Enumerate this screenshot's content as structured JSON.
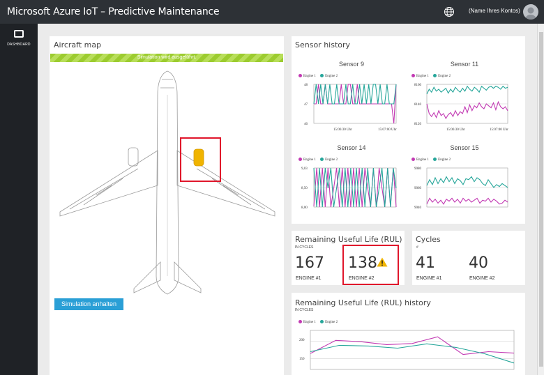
{
  "app": {
    "title": "Microsoft Azure IoT – Predictive Maintenance",
    "account": "(Name Ihres Kontos)"
  },
  "sidebar": {
    "items": [
      {
        "label": "DASHBOARD",
        "icon": "dashboard-icon"
      }
    ]
  },
  "aircraft_map": {
    "title": "Aircraft map",
    "banner": "Simulation wird ausgeführt.",
    "stop_button": "Simulation anhalten"
  },
  "sensor_history": {
    "title": "Sensor history",
    "legend": [
      "Engine 1",
      "Engine 2"
    ],
    "colors": {
      "engine1": "#c239b3",
      "engine2": "#26a69a"
    },
    "charts": [
      {
        "title": "Sensor 9",
        "yticks": [
          "48",
          "47",
          "46"
        ],
        "xticks": [
          "15:06:30 Uhr",
          "15:07:00 Uhr"
        ]
      },
      {
        "title": "Sensor 11",
        "yticks": [
          "8160",
          "8140",
          "8120"
        ],
        "xticks": [
          "15:06:30 Uhr",
          "15:07:00 Uhr"
        ]
      },
      {
        "title": "Sensor 14",
        "yticks": [
          "9,03",
          "8,50",
          "8,00"
        ],
        "xticks": [
          "15:06:30 Uhr",
          "15:07:00 Uhr"
        ]
      },
      {
        "title": "Sensor 15",
        "yticks": [
          "9080",
          "9060",
          "9040"
        ],
        "xticks": [
          "15:06:30 Uhr",
          "15:07:00 Uhr"
        ]
      }
    ]
  },
  "rul": {
    "title": "Remaining Useful Life (RUL)",
    "subtitle": "IN CYCLES",
    "engine1": {
      "value": "167",
      "label": "ENGINE #1"
    },
    "engine2": {
      "value": "138",
      "label": "ENGINE #2",
      "warning": true
    }
  },
  "cycles": {
    "title": "Cycles",
    "subtitle": "#",
    "engine1": {
      "value": "41",
      "label": "ENGINE #1"
    },
    "engine2": {
      "value": "40",
      "label": "ENGINE #2"
    }
  },
  "rul_history": {
    "title": "Remaining Useful Life (RUL) history",
    "subtitle": "IN CYCLES",
    "legend": [
      "Engine 1",
      "Engine 2"
    ],
    "yticks": [
      "200",
      "150"
    ]
  },
  "chart_data": [
    {
      "type": "line",
      "title": "Sensor 9",
      "ylim": [
        46,
        48
      ],
      "series": [
        {
          "name": "Engine 1",
          "values": [
            47,
            47,
            48,
            47,
            47,
            48,
            47,
            47,
            47,
            47,
            47,
            47,
            48,
            47,
            47,
            48,
            48,
            47,
            47,
            48,
            47,
            47,
            47,
            47,
            47,
            47,
            47,
            47,
            47,
            47,
            47,
            47,
            47,
            47,
            47,
            46,
            48
          ]
        },
        {
          "name": "Engine 2",
          "values": [
            47,
            48,
            47,
            48,
            47,
            48,
            47,
            48,
            47,
            47,
            48,
            47,
            47,
            47,
            48,
            47,
            47,
            48,
            47,
            47,
            48,
            47,
            48,
            47,
            48,
            47,
            48,
            48,
            47,
            48,
            47,
            47,
            48,
            47,
            47,
            47,
            48
          ]
        }
      ]
    },
    {
      "type": "line",
      "title": "Sensor 11",
      "series": [
        {
          "name": "Engine 1",
          "values": [
            8140,
            8130,
            8127,
            8131,
            8126,
            8133,
            8128,
            8130,
            8125,
            8129,
            8131,
            8127,
            8133,
            8128,
            8132,
            8130,
            8137,
            8131,
            8139,
            8133,
            8138,
            8136,
            8141,
            8137,
            8135,
            8140,
            8138,
            8136,
            8141,
            8134,
            8142,
            8137,
            8135,
            8137,
            8133
          ]
        },
        {
          "name": "Engine 2",
          "values": [
            8150,
            8155,
            8152,
            8157,
            8153,
            8155,
            8152,
            8154,
            8156,
            8151,
            8155,
            8152,
            8157,
            8154,
            8152,
            8156,
            8153,
            8158,
            8155,
            8153,
            8157,
            8155,
            8152,
            8158,
            8156,
            8154,
            8157,
            8158,
            8156,
            8158,
            8157,
            8155,
            8158,
            8156,
            8157
          ]
        }
      ]
    },
    {
      "type": "line",
      "title": "Sensor 14",
      "series": [
        {
          "name": "Engine 1",
          "values": [
            8.02,
            9.03,
            8.0,
            9.03,
            8.0,
            9.03,
            8.0,
            8.5,
            9.03,
            8.0,
            9.03,
            8.0,
            9.03,
            8.0,
            9.03,
            8.0,
            9.03,
            8.0,
            9.03,
            8.5,
            8.0,
            9.03,
            8.0,
            9.03,
            8.5,
            8.0,
            9.03,
            8.0,
            9.03,
            8.0
          ]
        },
        {
          "name": "Engine 2",
          "values": [
            9.03,
            8.0,
            9.03,
            8.0,
            9.03,
            8.5,
            9.03,
            8.0,
            8.5,
            9.03,
            8.0,
            9.03,
            8.0,
            9.03,
            8.0,
            9.03,
            8.0,
            9.03,
            8.0,
            9.03,
            8.0,
            9.03,
            8.0,
            8.5,
            9.03,
            8.0,
            9.03,
            8.0,
            9.03,
            8.5
          ]
        }
      ]
    },
    {
      "type": "line",
      "title": "Sensor 15",
      "series": [
        {
          "name": "Engine 1",
          "values": [
            9043,
            9049,
            9045,
            9048,
            9044,
            9047,
            9043,
            9048,
            9046,
            9049,
            9045,
            9048,
            9044,
            9049,
            9046,
            9048,
            9045,
            9047,
            9049,
            9044,
            9047,
            9046,
            9049,
            9045,
            9048,
            9046,
            9043,
            9044,
            9047,
            9045
          ]
        },
        {
          "name": "Engine 2",
          "values": [
            9062,
            9068,
            9063,
            9070,
            9064,
            9069,
            9065,
            9071,
            9066,
            9070,
            9064,
            9069,
            9067,
            9063,
            9069,
            9068,
            9071,
            9066,
            9070,
            9068,
            9064,
            9062,
            9068,
            9064,
            9060,
            9063,
            9061,
            9064,
            9062,
            9060
          ]
        }
      ]
    },
    {
      "type": "line",
      "title": "Remaining Useful Life (RUL) history",
      "series": [
        {
          "name": "Engine 1",
          "values": [
            165,
            202,
            198,
            190,
            193,
            212,
            162,
            170,
            166
          ]
        },
        {
          "name": "Engine 2",
          "values": [
            170,
            188,
            186,
            180,
            192,
            182,
            164,
            138
          ]
        }
      ]
    }
  ]
}
